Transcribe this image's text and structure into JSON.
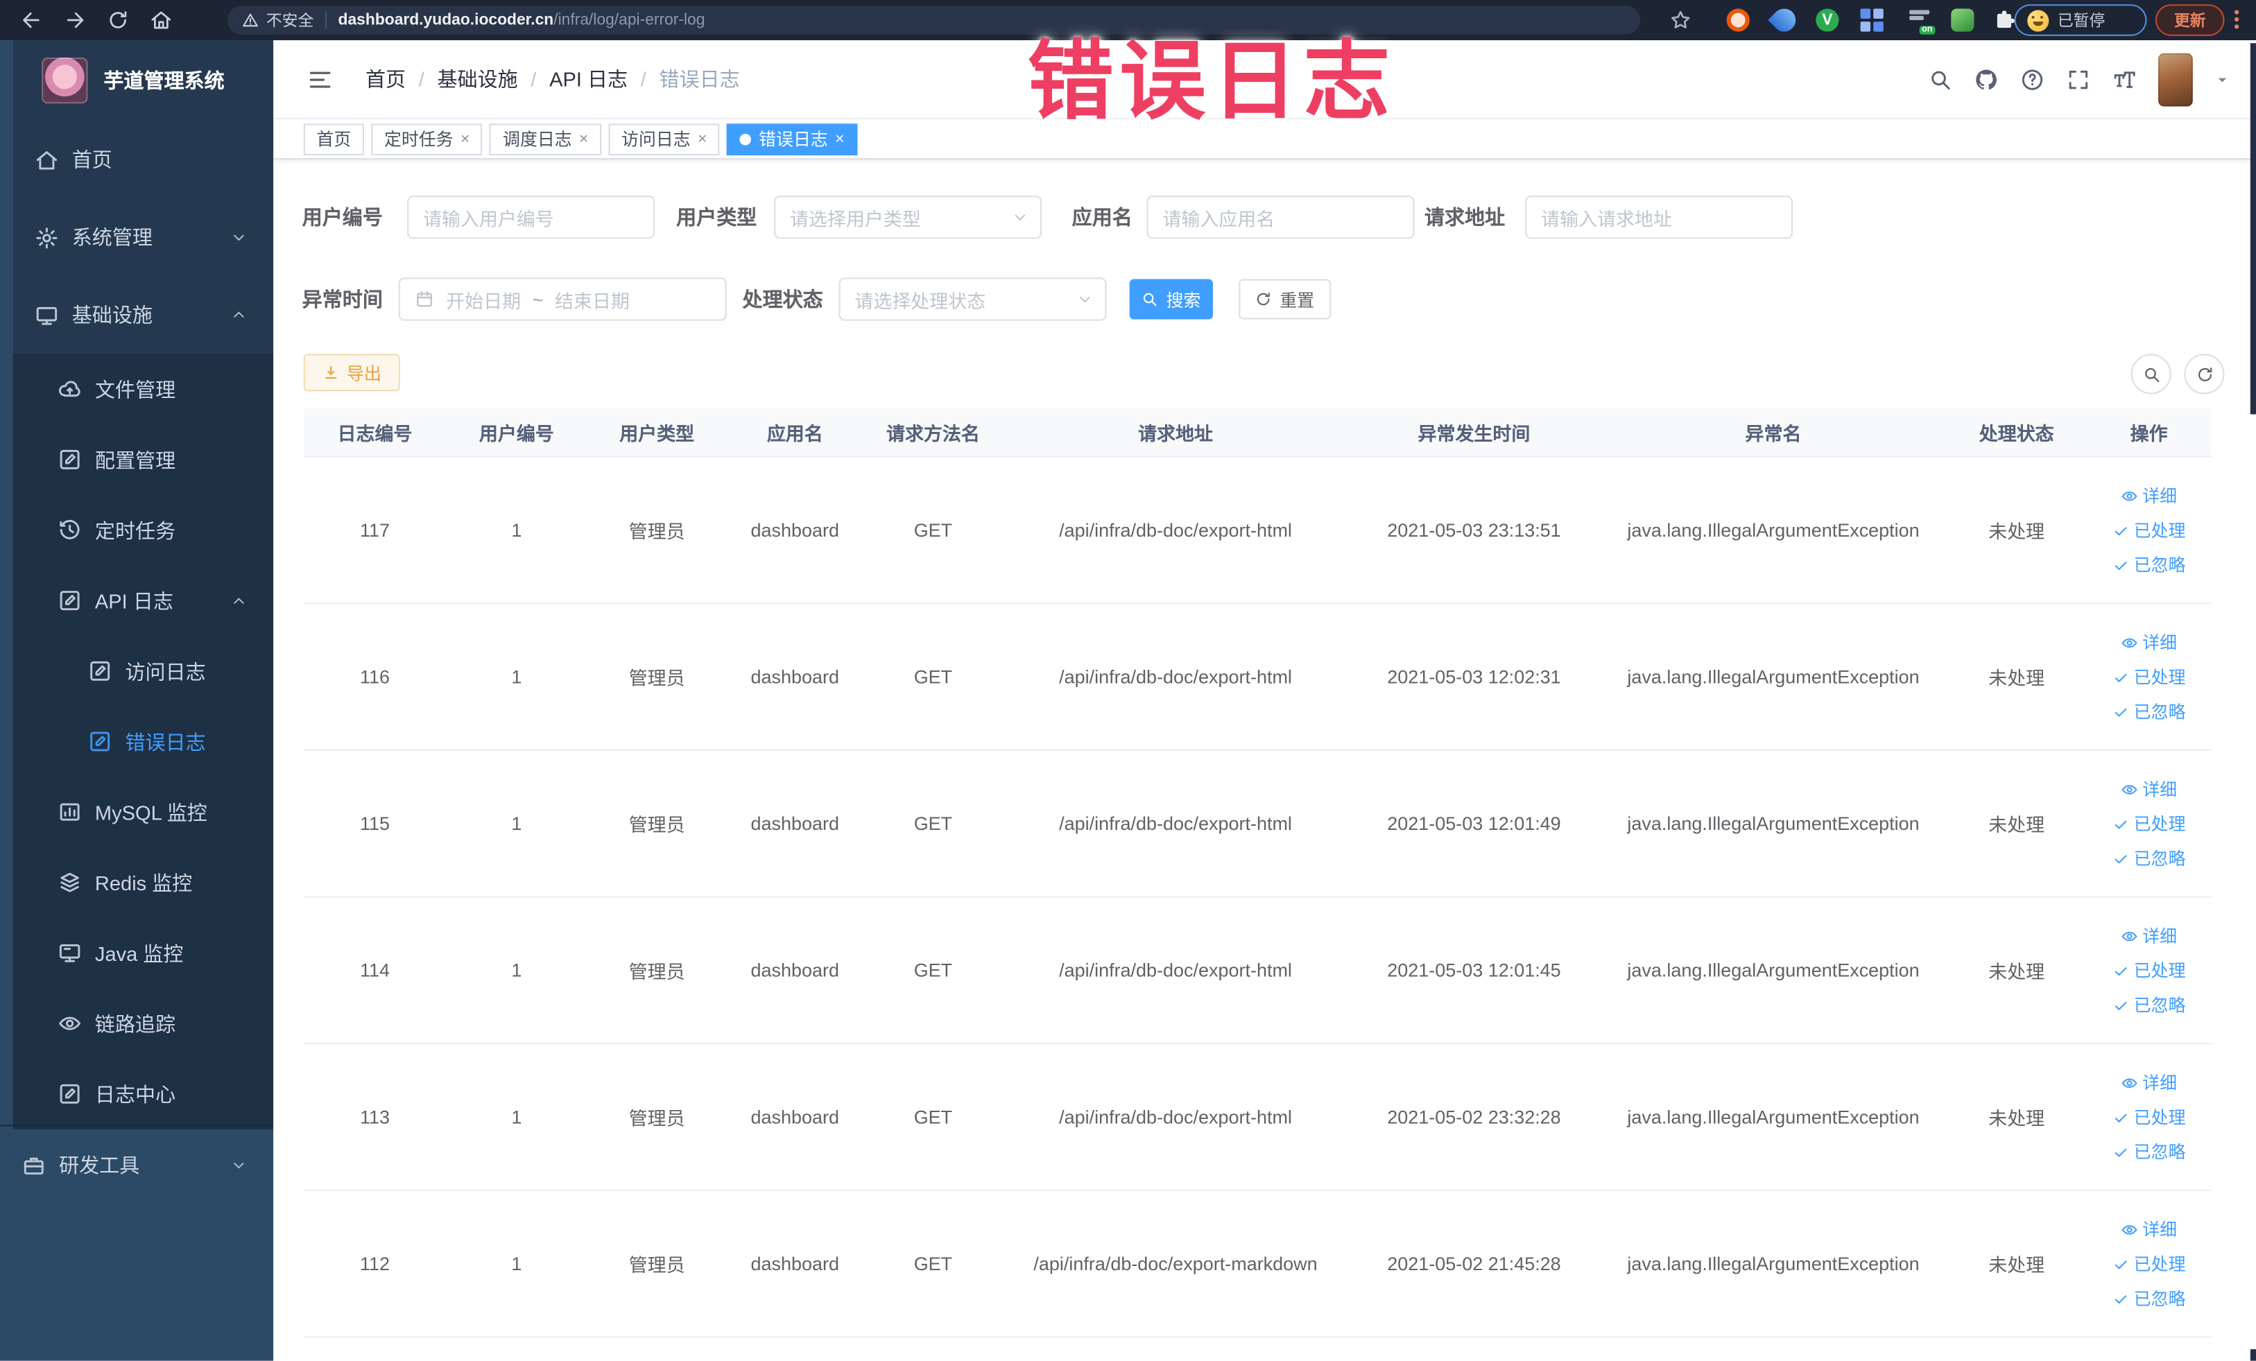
{
  "browser": {
    "security_label": "不安全",
    "url_domain": "dashboard.yudao.iocoder.cn",
    "url_path": "/infra/log/api-error-log",
    "profile_label": "已暂停",
    "update_label": "更新",
    "extension_badge": "on"
  },
  "watermark": {
    "text": "错误日志",
    "color": "#ee3f63"
  },
  "sidebar": {
    "title": "芋道管理系统",
    "items": [
      {
        "label": "首页",
        "icon": "home-icon"
      },
      {
        "label": "系统管理",
        "icon": "gear-icon",
        "arrow": "down"
      },
      {
        "label": "基础设施",
        "icon": "monitor-icon",
        "arrow": "up"
      },
      {
        "label": "文件管理",
        "icon": "cloud-upload-icon"
      },
      {
        "label": "配置管理",
        "icon": "edit-square-icon"
      },
      {
        "label": "定时任务",
        "icon": "history-icon"
      },
      {
        "label": "API 日志",
        "icon": "log-icon",
        "arrow": "up"
      },
      {
        "label": "访问日志",
        "icon": "log-icon"
      },
      {
        "label": "错误日志",
        "icon": "log-icon",
        "active": true
      },
      {
        "label": "MySQL 监控",
        "icon": "chart-icon"
      },
      {
        "label": "Redis 监控",
        "icon": "layers-icon"
      },
      {
        "label": "Java 监控",
        "icon": "display-icon"
      },
      {
        "label": "链路追踪",
        "icon": "eye-icon"
      },
      {
        "label": "日志中心",
        "icon": "log-icon"
      },
      {
        "label": "研发工具",
        "icon": "toolbox-icon",
        "arrow": "down"
      }
    ]
  },
  "header": {
    "breadcrumb": [
      "首页",
      "基础设施",
      "API 日志",
      "错误日志"
    ],
    "separator": "/"
  },
  "tabs": [
    {
      "label": "首页"
    },
    {
      "label": "定时任务",
      "closable": true
    },
    {
      "label": "调度日志",
      "closable": true
    },
    {
      "label": "访问日志",
      "closable": true
    },
    {
      "label": "错误日志",
      "closable": true,
      "active": true
    }
  ],
  "ui": {
    "close_glyph": "×"
  },
  "filters": {
    "user_id": {
      "label": "用户编号",
      "placeholder": "请输入用户编号"
    },
    "user_type": {
      "label": "用户类型",
      "placeholder": "请选择用户类型"
    },
    "app_name": {
      "label": "应用名",
      "placeholder": "请输入应用名"
    },
    "request_url": {
      "label": "请求地址",
      "placeholder": "请输入请求地址"
    },
    "exception_time": {
      "label": "异常时间",
      "start_placeholder": "开始日期",
      "separator": "~",
      "end_placeholder": "结束日期"
    },
    "process_status": {
      "label": "处理状态",
      "placeholder": "请选择处理状态"
    },
    "search_label": "搜索",
    "reset_label": "重置"
  },
  "toolbar": {
    "export_label": "导出"
  },
  "table": {
    "columns": [
      "日志编号",
      "用户编号",
      "用户类型",
      "应用名",
      "请求方法名",
      "请求地址",
      "异常发生时间",
      "异常名",
      "处理状态",
      "操作"
    ],
    "actions": {
      "detail": "详细",
      "processed": "已处理",
      "ignored": "已忽略"
    },
    "rows": [
      {
        "id": "117",
        "user_id": "1",
        "user_type": "管理员",
        "app": "dashboard",
        "method": "GET",
        "url": "/api/infra/db-doc/export-html",
        "time": "2021-05-03 23:13:51",
        "exception": "java.lang.IllegalArgumentException",
        "status": "未处理"
      },
      {
        "id": "116",
        "user_id": "1",
        "user_type": "管理员",
        "app": "dashboard",
        "method": "GET",
        "url": "/api/infra/db-doc/export-html",
        "time": "2021-05-03 12:02:31",
        "exception": "java.lang.IllegalArgumentException",
        "status": "未处理"
      },
      {
        "id": "115",
        "user_id": "1",
        "user_type": "管理员",
        "app": "dashboard",
        "method": "GET",
        "url": "/api/infra/db-doc/export-html",
        "time": "2021-05-03 12:01:49",
        "exception": "java.lang.IllegalArgumentException",
        "status": "未处理"
      },
      {
        "id": "114",
        "user_id": "1",
        "user_type": "管理员",
        "app": "dashboard",
        "method": "GET",
        "url": "/api/infra/db-doc/export-html",
        "time": "2021-05-03 12:01:45",
        "exception": "java.lang.IllegalArgumentException",
        "status": "未处理"
      },
      {
        "id": "113",
        "user_id": "1",
        "user_type": "管理员",
        "app": "dashboard",
        "method": "GET",
        "url": "/api/infra/db-doc/export-html",
        "time": "2021-05-02 23:32:28",
        "exception": "java.lang.IllegalArgumentException",
        "status": "未处理"
      },
      {
        "id": "112",
        "user_id": "1",
        "user_type": "管理员",
        "app": "dashboard",
        "method": "GET",
        "url": "/api/infra/db-doc/export-markdown",
        "time": "2021-05-02 21:45:28",
        "exception": "java.lang.IllegalArgumentException",
        "status": "未处理"
      }
    ]
  },
  "colors": {
    "primary": "#409eff",
    "warning": "#e6a23c",
    "sidebar_bg": "#24394f",
    "watermark": "#ee3f63"
  }
}
